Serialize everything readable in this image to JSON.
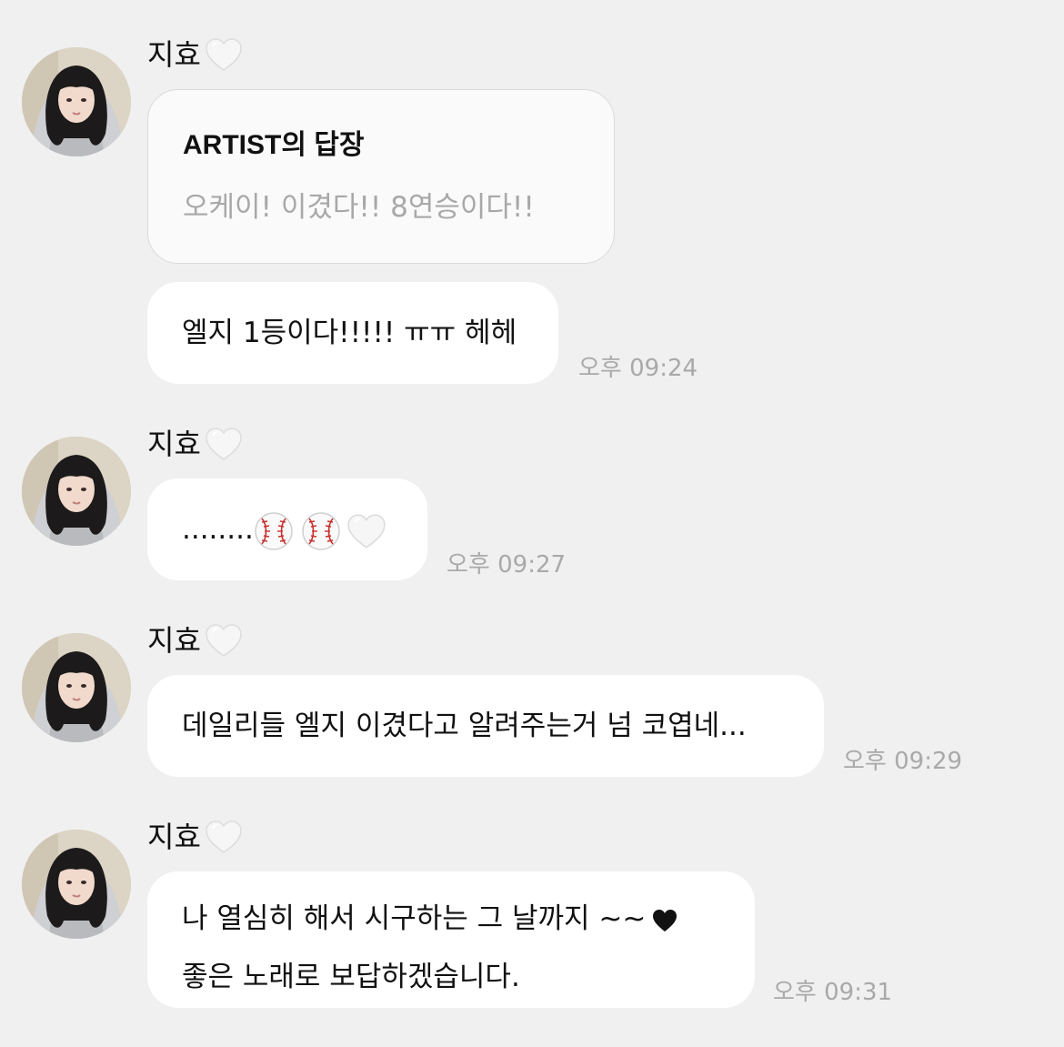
{
  "messages": [
    {
      "sender": "지효",
      "reply": {
        "title": "ARTIST의 답장",
        "text": "오케이! 이겼다!! 8연승이다!!"
      },
      "text": "엘지 1등이다!!!!! ㅠㅠ 헤헤",
      "time": "오후 09:24"
    },
    {
      "sender": "지효",
      "text": "........",
      "time": "오후 09:27"
    },
    {
      "sender": "지효",
      "text": "데일리들 엘지 이겼다고 알려주는거 넘 코엽네...",
      "time": "오후 09:29"
    },
    {
      "sender": "지효",
      "text_line1": "나 열심히 해서 시구하는 그 날까지 ~~",
      "text_line2": "좋은 노래로 보답하겠습니다.",
      "time": "오후 09:31"
    }
  ],
  "icons": {
    "sender_heart": "white-heart-icon",
    "baseball": "baseball-icon",
    "black_heart": "black-heart-icon"
  },
  "colors": {
    "background": "#f0f0f0",
    "bubble": "#ffffff",
    "reply_text": "#a8a8a8",
    "timestamp": "#a9a9a9"
  }
}
